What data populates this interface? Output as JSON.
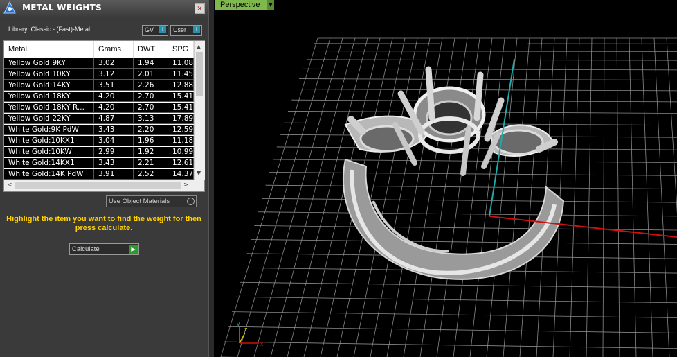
{
  "panel": {
    "title": "METAL WEIGHTS",
    "close_glyph": "×",
    "library_label": "Library: Classic - (Fast)-Metal",
    "gv_toggle": "GV",
    "user_toggle": "User",
    "toggle_glyph": "I"
  },
  "table": {
    "columns": [
      "Metal",
      "Grams",
      "DWT",
      "SPG"
    ],
    "rows": [
      {
        "metal": "Yellow Gold:9KY",
        "grams": "3.02",
        "dwt": "1.94",
        "spg": "11.08"
      },
      {
        "metal": "Yellow Gold:10KY",
        "grams": "3.12",
        "dwt": "2.01",
        "spg": "11.45"
      },
      {
        "metal": "Yellow Gold:14KY",
        "grams": "3.51",
        "dwt": "2.26",
        "spg": "12.88"
      },
      {
        "metal": "Yellow Gold:18KY",
        "grams": "4.20",
        "dwt": "2.70",
        "spg": "15.41"
      },
      {
        "metal": "Yellow Gold:18KY R...",
        "grams": "4.20",
        "dwt": "2.70",
        "spg": "15.41"
      },
      {
        "metal": "Yellow Gold:22KY",
        "grams": "4.87",
        "dwt": "3.13",
        "spg": "17.89"
      },
      {
        "metal": "White Gold:9K PdW",
        "grams": "3.43",
        "dwt": "2.20",
        "spg": "12.59"
      },
      {
        "metal": "White Gold:10KX1",
        "grams": "3.04",
        "dwt": "1.96",
        "spg": "11.18"
      },
      {
        "metal": "White Gold:10KW",
        "grams": "2.99",
        "dwt": "1.92",
        "spg": "10.99"
      },
      {
        "metal": "White Gold:14KX1",
        "grams": "3.43",
        "dwt": "2.21",
        "spg": "12.61"
      },
      {
        "metal": "White Gold:14K PdW",
        "grams": "3.91",
        "dwt": "2.52",
        "spg": "14.37"
      }
    ],
    "scroll_up": "▲",
    "scroll_down": "▼",
    "scroll_left": "<",
    "scroll_right": ">"
  },
  "use_object_materials": "Use Object Materials",
  "instruction": "Highlight the item you want to find the weight for then press calculate.",
  "calculate_button": "Calculate",
  "calculate_glyph": "▶",
  "viewport": {
    "label": "Perspective",
    "dropdown_glyph": "▼",
    "axis_x": "x",
    "axis_y": "y",
    "axis_z": "z"
  },
  "colors": {
    "accent_yellow": "#ffd200",
    "viewport_tab": "#7fb94b",
    "axis_x": "#cc1111",
    "axis_y": "#1fa9a9",
    "grid": "#8a8a8a"
  },
  "icons": {
    "logo": "matrix-logo-icon",
    "close": "close-icon",
    "play": "play-icon"
  }
}
